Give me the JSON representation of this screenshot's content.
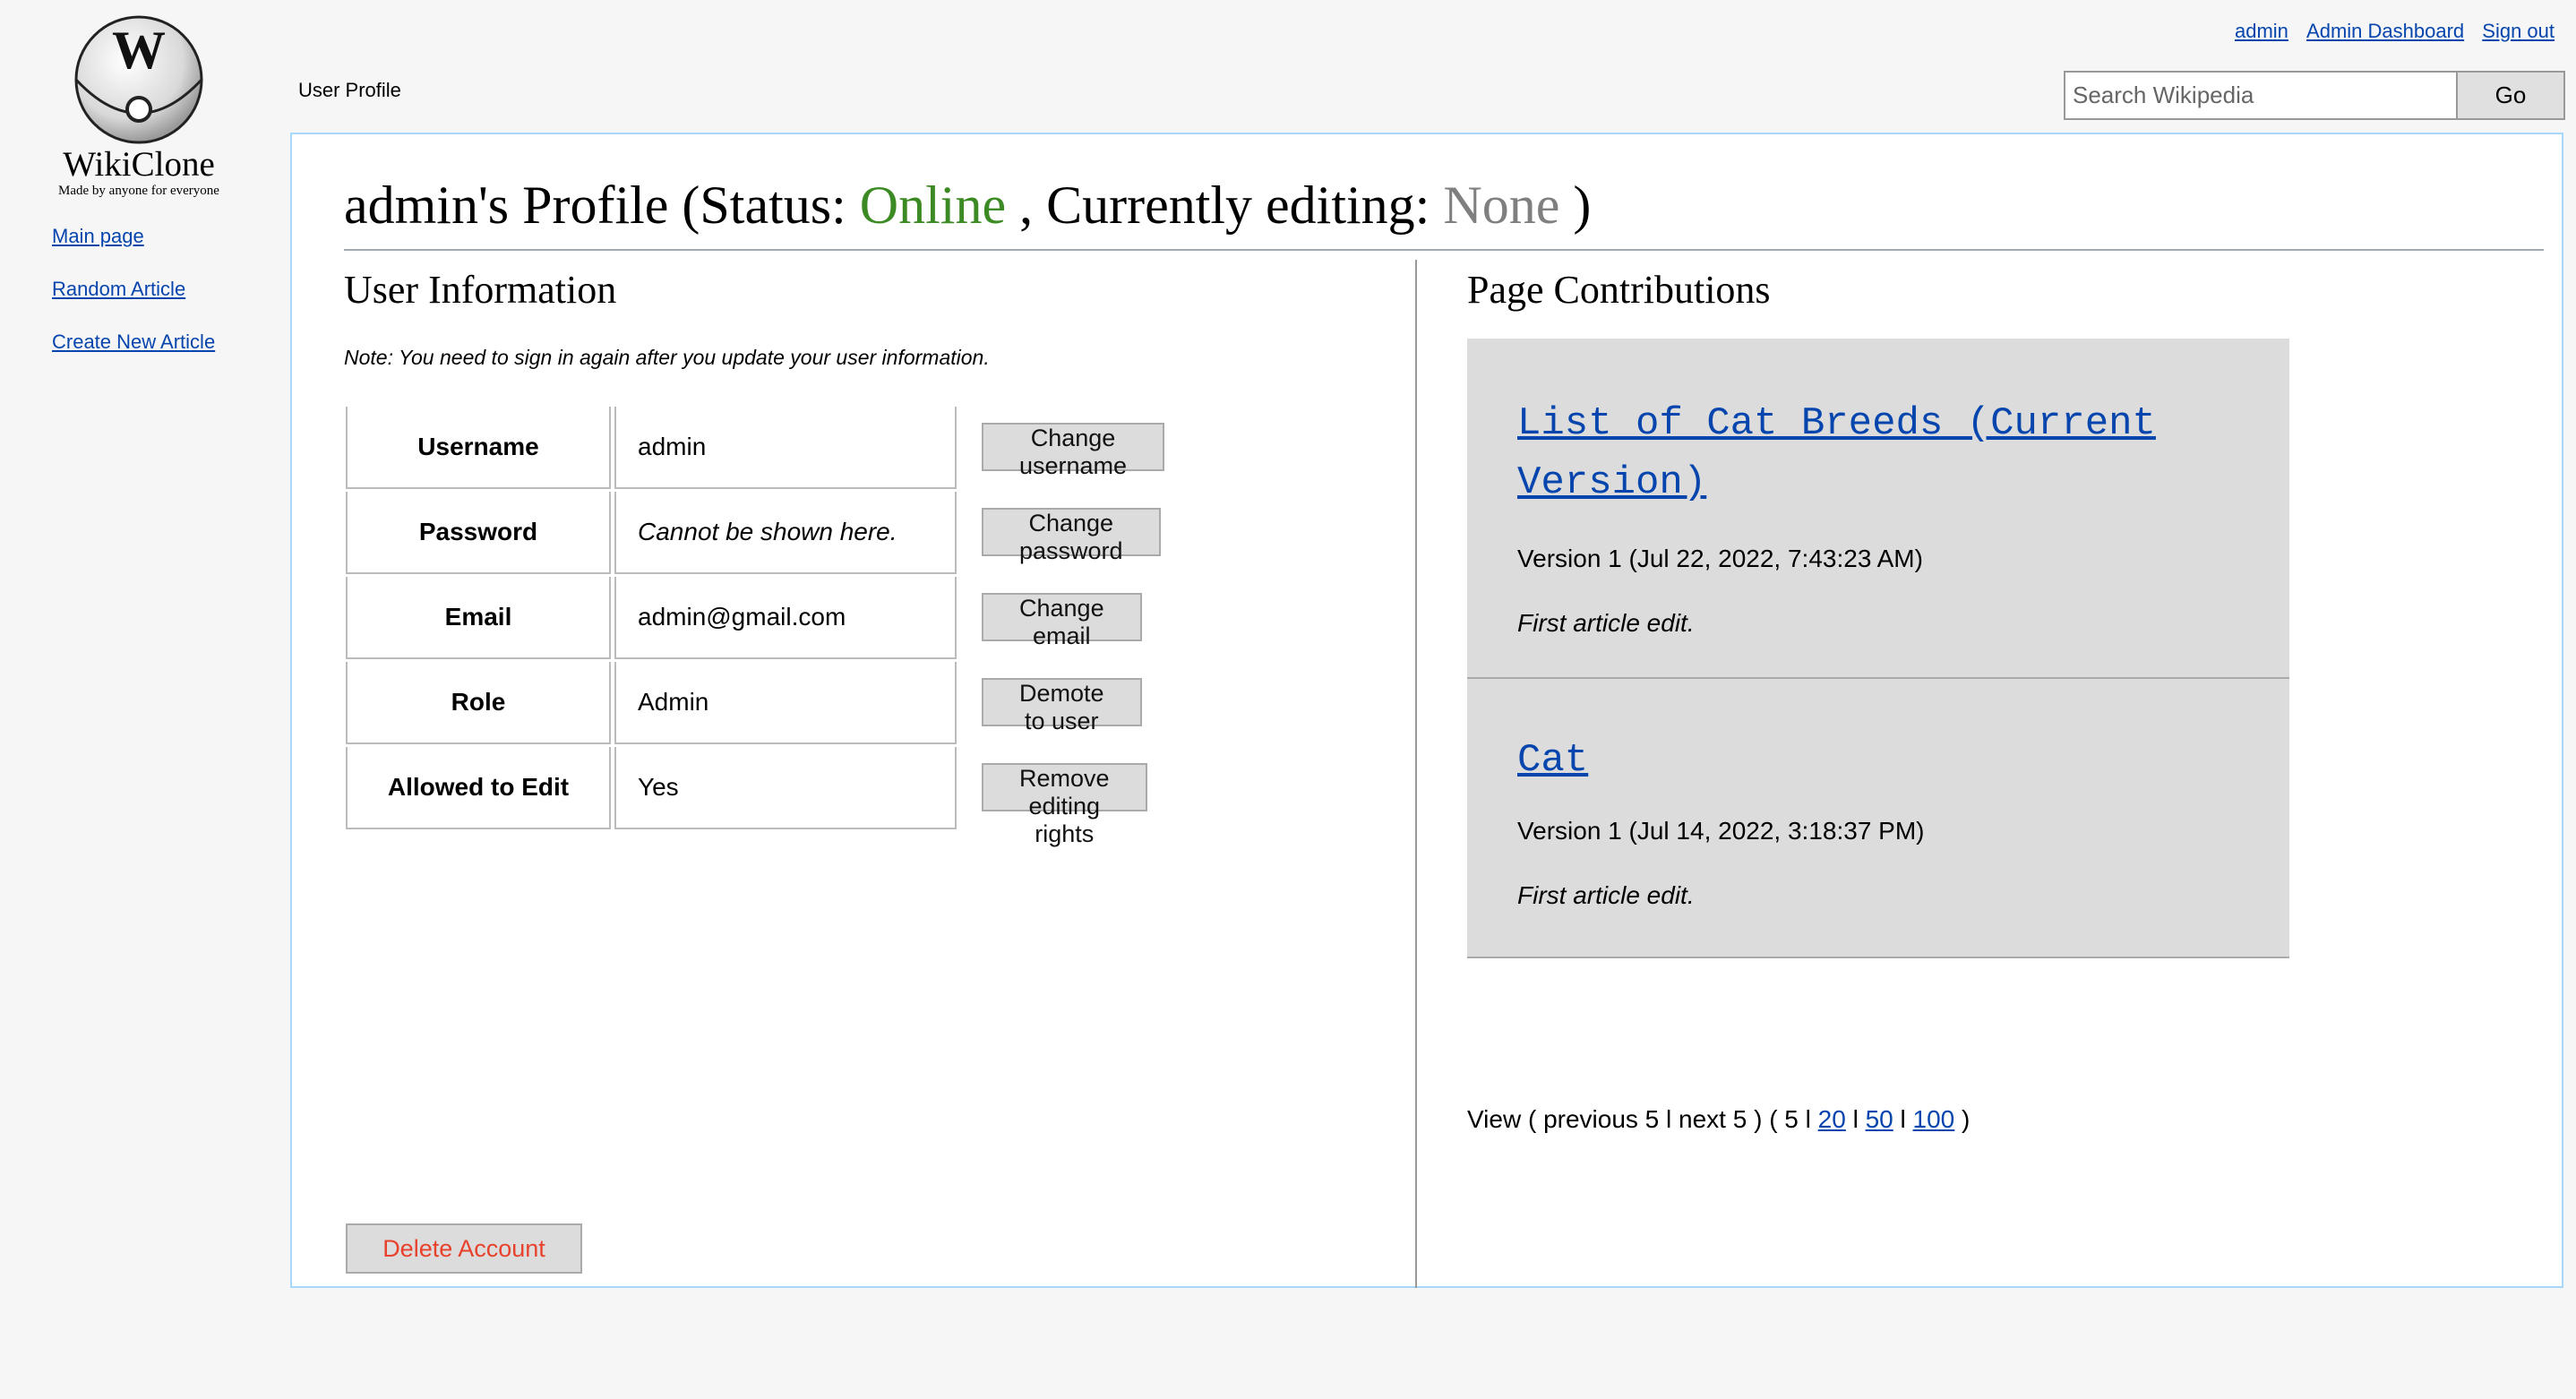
{
  "site": {
    "name": "WikiClone",
    "tagline": "Made by anyone for everyone",
    "logo_letter": "W",
    "logo_icon": "globe-logo-icon"
  },
  "sidebar": {
    "items": [
      {
        "label": "Main page"
      },
      {
        "label": "Random Article"
      },
      {
        "label": "Create New Article"
      }
    ]
  },
  "header": {
    "user_link": "admin",
    "dashboard_link": "Admin Dashboard",
    "signout_link": "Sign out",
    "page_tab": "User Profile",
    "search_placeholder": "Search Wikipedia",
    "search_value": "",
    "go_label": "Go"
  },
  "profile": {
    "heading_prefix": "admin's Profile (Status: ",
    "status": "Online",
    "heading_middle": " , Currently editing: ",
    "editing": "None",
    "heading_suffix": " )",
    "status_color": "#3c8a23"
  },
  "user_info": {
    "title": "User Information",
    "note": "Note: You need to sign in again after you update your user information.",
    "rows": [
      {
        "label": "Username",
        "value": "admin",
        "button": "Change username"
      },
      {
        "label": "Password",
        "value": "Cannot be shown here.",
        "button": "Change password"
      },
      {
        "label": "Email",
        "value": "admin@gmail.com",
        "button": "Change email"
      },
      {
        "label": "Role",
        "value": "Admin",
        "button": "Demote to user"
      },
      {
        "label": "Allowed to Edit",
        "value": "Yes",
        "button": "Remove editing rights"
      }
    ],
    "delete_label": "Delete Account",
    "delete_color": "#e8412c"
  },
  "contributions": {
    "title": "Page Contributions",
    "items": [
      {
        "title": "List of Cat Breeds (Current Version)",
        "version": "Version 1 (Jul 22, 2022, 7:43:23 AM)",
        "summary": "First article edit."
      },
      {
        "title": "Cat",
        "version": "Version 1 (Jul 14, 2022, 3:18:37 PM)",
        "summary": "First article edit."
      }
    ],
    "pager": {
      "prefix": "View ( previous 5 l next 5 ) ( 5 l ",
      "link_20": "20",
      "sep1": " l ",
      "link_50": "50",
      "sep2": " l ",
      "link_100": "100",
      "suffix": " )"
    }
  }
}
